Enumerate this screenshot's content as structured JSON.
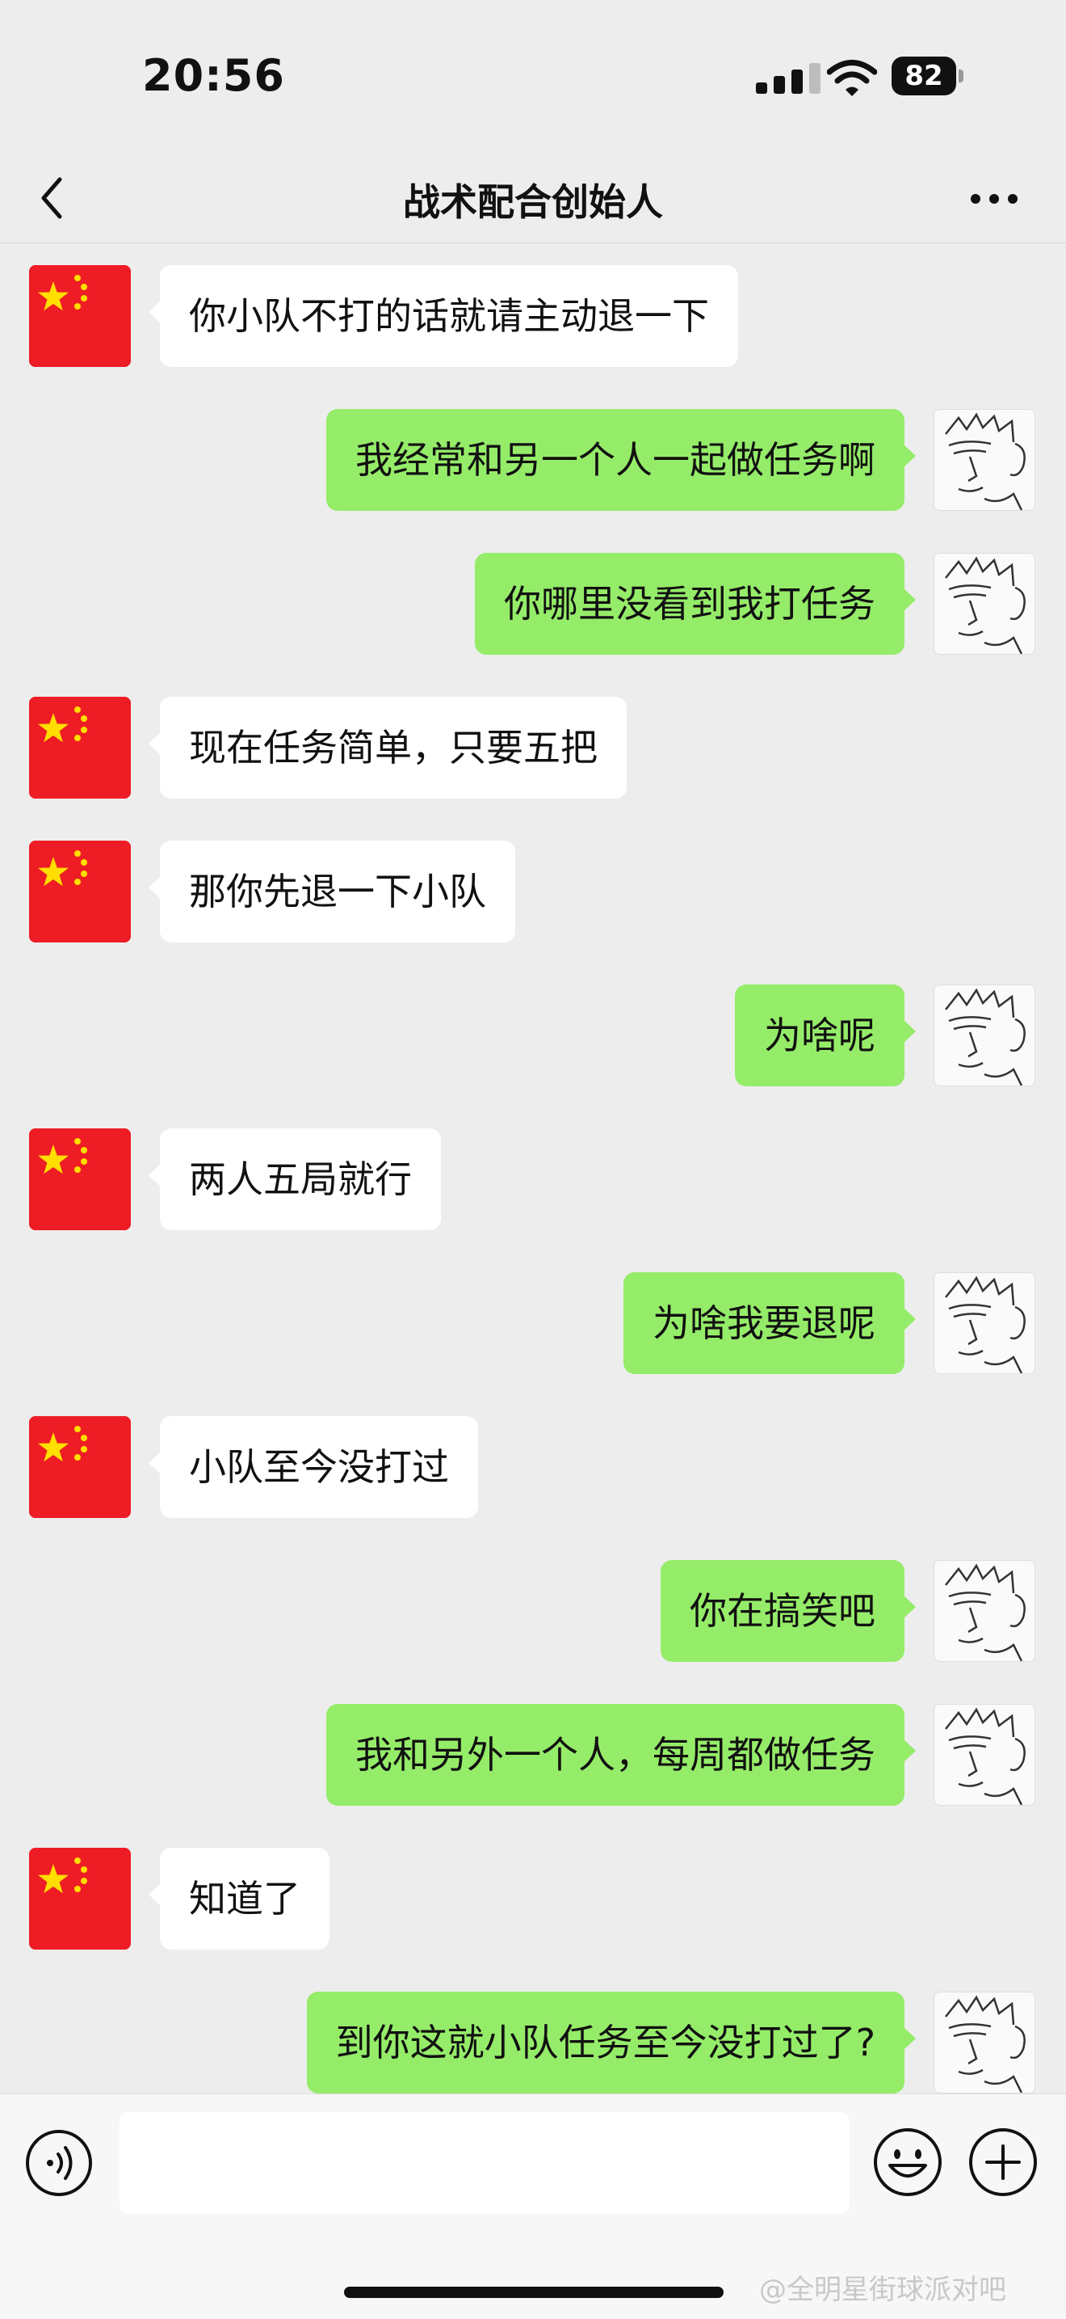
{
  "status": {
    "time": "20:56",
    "battery": "82"
  },
  "nav": {
    "title": "战术配合创始人"
  },
  "messages": [
    {
      "side": "left",
      "text": "你小队不打的话就请主动退一下"
    },
    {
      "side": "right",
      "text": "我经常和另一个人一起做任务啊"
    },
    {
      "side": "right",
      "text": "你哪里没看到我打任务"
    },
    {
      "side": "left",
      "text": "现在任务简单，只要五把"
    },
    {
      "side": "left",
      "text": "那你先退一下小队"
    },
    {
      "side": "right",
      "text": "为啥呢"
    },
    {
      "side": "left",
      "text": "两人五局就行"
    },
    {
      "side": "right",
      "text": "为啥我要退呢"
    },
    {
      "side": "left",
      "text": "小队至今没打过"
    },
    {
      "side": "right",
      "text": "你在搞笑吧"
    },
    {
      "side": "right",
      "text": "我和另外一个人，每周都做任务"
    },
    {
      "side": "left",
      "text": "知道了"
    },
    {
      "side": "right",
      "text": "到你这就小队任务至今没打过了?"
    }
  ],
  "watermark": "@全明星街球派对吧",
  "colors": {
    "own_bubble": "#95ec69",
    "other_bubble": "#ffffff",
    "background": "#ededed",
    "flag_red": "#ee1c25",
    "flag_star": "#ffde00"
  },
  "icons": {
    "back": "chevron-left-icon",
    "more": "more-dots-icon",
    "voice": "voice-icon",
    "emoji": "emoji-icon",
    "plus": "plus-icon"
  }
}
